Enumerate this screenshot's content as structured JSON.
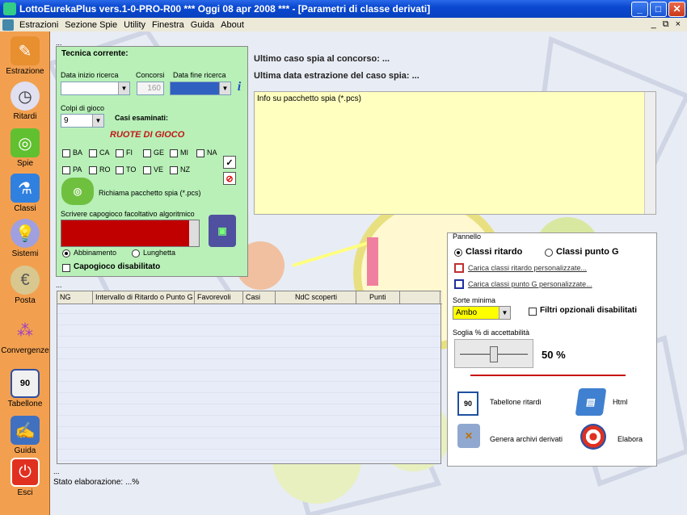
{
  "window": {
    "title": "LottoEurekaPlus vers.1-0-PRO-R00  ***  Oggi 08 apr 2008  ***  - [Parametri di classe derivati]",
    "min": "_",
    "max": "□",
    "close": "✕"
  },
  "menu": {
    "items": [
      "Estrazioni",
      "Sezione Spie",
      "Utility",
      "Finestra",
      "Guida",
      "About"
    ],
    "right": [
      "_",
      "⧉",
      "×"
    ]
  },
  "sidebar": [
    {
      "label": "Estrazione",
      "icon": "pencil-icon"
    },
    {
      "label": "Ritardi",
      "icon": "clock-icon"
    },
    {
      "label": "Spie",
      "icon": "binoculars-icon"
    },
    {
      "label": "Classi",
      "icon": "flask-icon"
    },
    {
      "label": "Sistemi",
      "icon": "lightbulb-icon"
    },
    {
      "label": "Posta",
      "icon": "coin-icon"
    },
    {
      "label": "Convergenze",
      "icon": "balls-icon"
    },
    {
      "label": "Tabellone",
      "icon": "board-icon"
    },
    {
      "label": "Guida",
      "icon": "book-icon"
    },
    {
      "label": "Esci",
      "icon": "power-icon"
    }
  ],
  "tecnica": {
    "title": "Tecnica corrente:",
    "data_inizio_label": "Data inizio ricerca",
    "concorsi_label": "Concorsi",
    "concorsi_value": "160",
    "data_fine_label": "Data fine ricerca",
    "colpi_label": "Colpi di gioco",
    "colpi_value": "9",
    "casi_label": "Casi esaminati:",
    "ruote_label": "RUOTE  DI  GIOCO",
    "ruote_row1": [
      "BA",
      "CA",
      "FI",
      "GE",
      "MI",
      "NA"
    ],
    "ruote_row2": [
      "PA",
      "RO",
      "TO",
      "VE",
      "NZ"
    ],
    "richiama_label": "Richiama pacchetto spia (*.pcs)",
    "capogioco_label": "Scrivere capogioco facoltativo algoritmico",
    "abbinamento_label": "Abbinamento",
    "lunghetta_label": "Lunghetta",
    "capogioco_disabilitato_label": "Capogioco disabilitato",
    "dots": "..."
  },
  "info": {
    "ultimo_caso": "Ultimo caso spia al concorso:  ...",
    "ultima_data": "Ultima data estrazione del caso spia:  ...",
    "box_text": "Info su pacchetto spia (*.pcs)"
  },
  "grid": {
    "dots": "...",
    "columns": [
      "NG",
      "Intervallo di Ritardo o Punto G",
      "Favorevoli",
      "Casi",
      "NdC scoperti",
      "Punti",
      ""
    ]
  },
  "pannello": {
    "title": "Pannello",
    "classi_ritardo": "Classi ritardo",
    "classi_punto_g": "Classi punto G",
    "carica_ritardo": "Carica classi ritardo personalizzate...",
    "carica_punto_g": "Carica classi punto G personalizzate...",
    "sorte_label": "Sorte minima",
    "sorte_value": "Ambo",
    "filtri_label": "Filtri opzionali disabilitati",
    "soglia_label": "Soglia % di accettabilità",
    "soglia_value": "50 %",
    "soglia_fraction": 0.5,
    "tabellone_label": "Tabellone ritardi",
    "tabellone_num": "90",
    "html_label": "Html",
    "genera_label": "Genera archivi derivati",
    "elabora_label": "Elabora"
  },
  "status": {
    "dots": "...",
    "text": "Stato elaborazione: ...%"
  },
  "colors": {
    "accent": "#ffff00",
    "brand": "#f2a050",
    "status_red": "#c81010"
  }
}
